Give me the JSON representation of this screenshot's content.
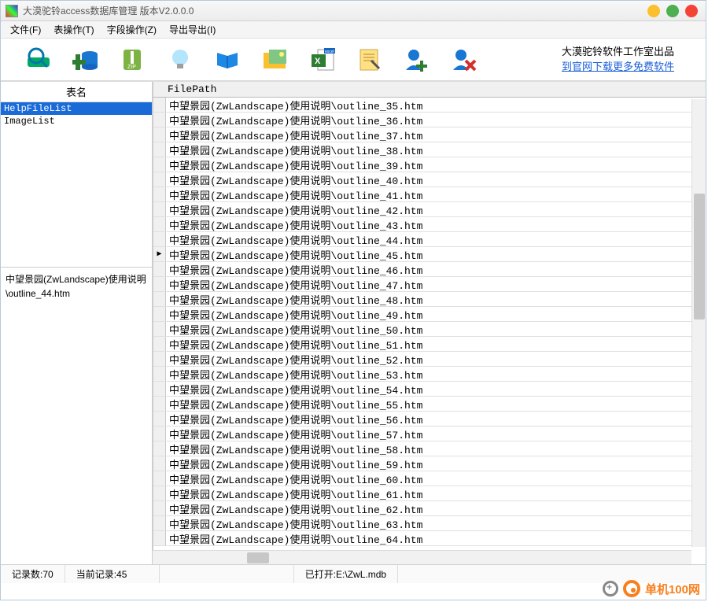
{
  "window": {
    "title": "大漠驼铃access数据库管理 版本V2.0.0.0"
  },
  "menubar": [
    {
      "label": "文件(F)"
    },
    {
      "label": "表操作(T)"
    },
    {
      "label": "字段操作(Z)"
    },
    {
      "label": "导出导出(I)"
    }
  ],
  "toolbar_icons": [
    "disk-scan-icon",
    "db-add-icon",
    "zip-icon",
    "lightbulb-icon",
    "book-icon",
    "folder-image-icon",
    "excel-export-icon",
    "clipboard-icon",
    "user-add-icon",
    "user-remove-icon"
  ],
  "promo": {
    "line1": "大漠驼铃软件工作室出品",
    "link": "到官网下载更多免费软件"
  },
  "left_header": "表名",
  "tables": [
    {
      "name": "HelpFileList",
      "selected": true
    },
    {
      "name": "ImageList",
      "selected": false
    }
  ],
  "detail_text": "中望景园(ZwLandscape)使用说明\\outline_44.htm",
  "grid": {
    "column": "FilePath",
    "row_prefix": "中望景园(ZwLandscape)使用说明\\outline_",
    "row_suffix": ".htm",
    "visible_start": 35,
    "visible_end": 64,
    "current_index": 45
  },
  "status": {
    "count_label": "记录数:",
    "count_value": "70",
    "current_label": "当前记录:",
    "current_value": "45",
    "opened_label": "已打开:",
    "opened_value": "E:\\ZwL.mdb"
  },
  "watermark": "单机100网"
}
